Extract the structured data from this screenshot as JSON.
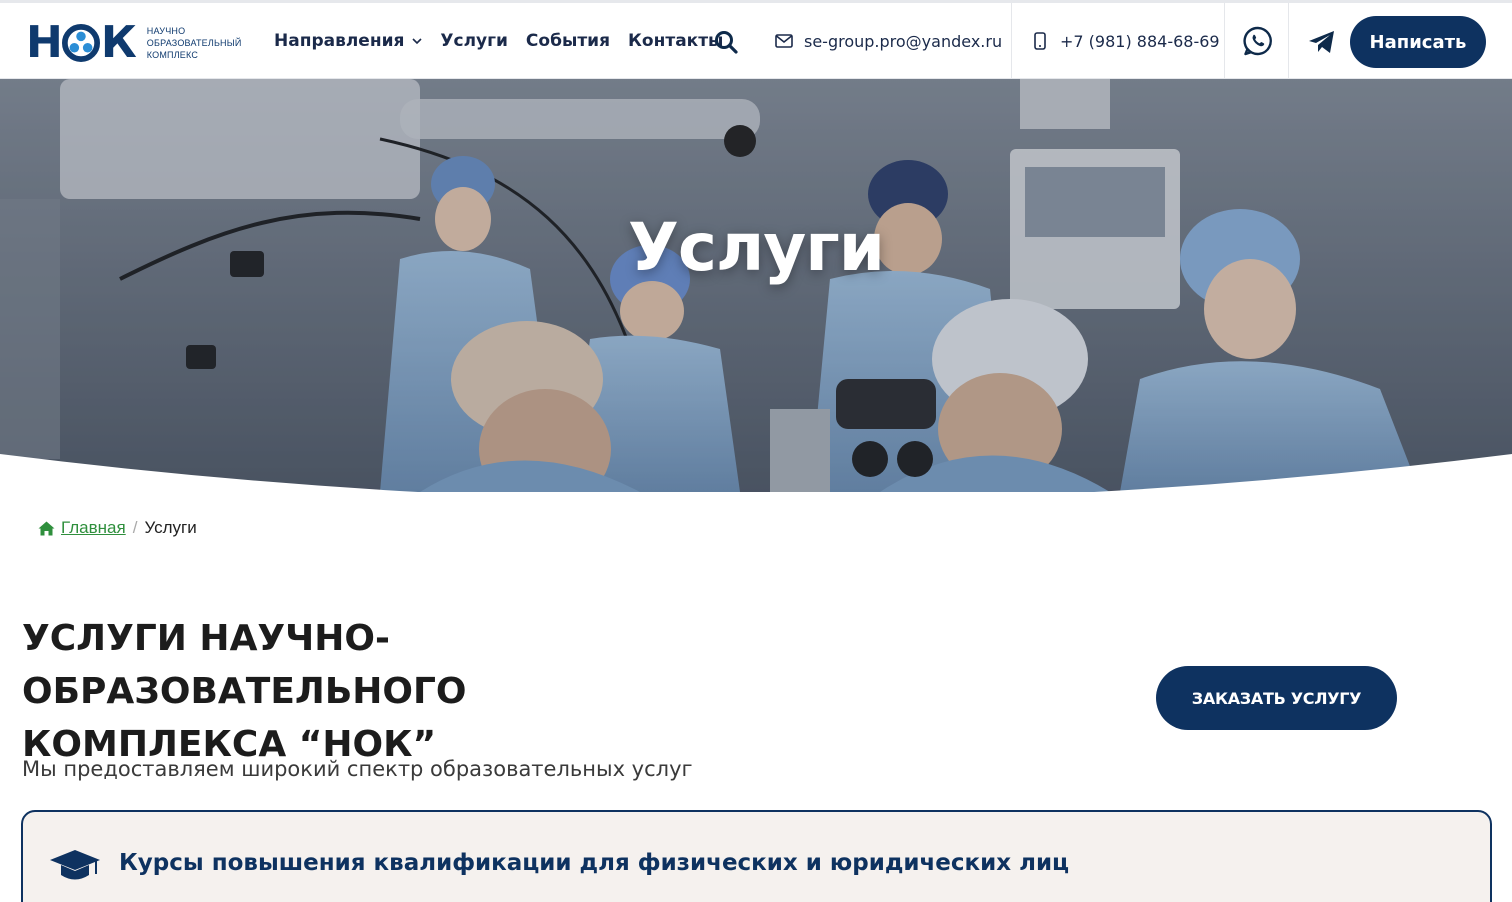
{
  "brand": {
    "logo_text": "НОК",
    "tagline_lines": [
      "Научно",
      "образовательный",
      "комплекс"
    ]
  },
  "nav": {
    "items": [
      {
        "label": "Направления",
        "has_dropdown": true
      },
      {
        "label": "Услуги",
        "has_dropdown": false
      },
      {
        "label": "События",
        "has_dropdown": false
      },
      {
        "label": "Контакты",
        "has_dropdown": false
      }
    ],
    "search_icon": "search-icon"
  },
  "contacts": {
    "email": "se-group.pro@yandex.ru",
    "phone": "+7 (981) 884-68-69"
  },
  "header_button": "Написать",
  "hero": {
    "title": "Услуги"
  },
  "breadcrumb": {
    "home": "Главная",
    "separator": "/",
    "current": "Услуги"
  },
  "main": {
    "title_line1": "Услуги научно-образовательного",
    "title_line2": "комплекса “НОК”",
    "order_button": "Заказать услугу",
    "lead": "Мы предоставляем широкий спектр образовательных услуг",
    "cards": [
      {
        "icon": "graduation-cap-icon",
        "title": "Курсы повышения квалификации для физических и юридических лиц"
      }
    ]
  },
  "colors": {
    "brand_navy": "#0e3260",
    "link_green": "#2f8f3d",
    "card_bg": "#f5f1ee"
  }
}
